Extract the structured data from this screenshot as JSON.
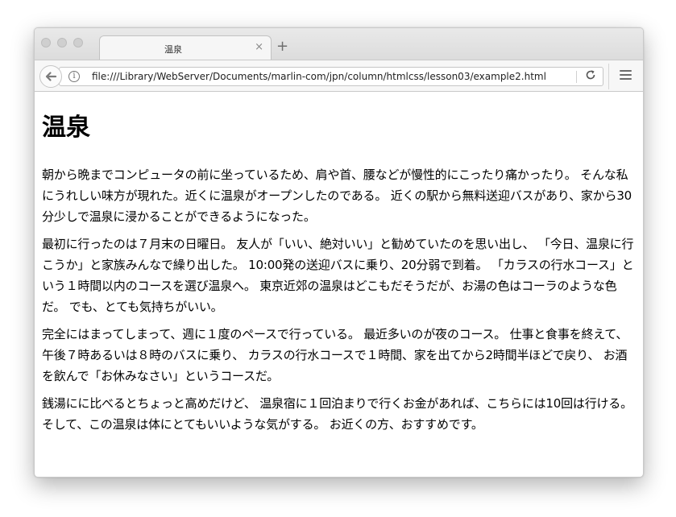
{
  "browser": {
    "tab": {
      "title": "温泉",
      "close_glyph": "×"
    },
    "new_tab_glyph": "+",
    "url": "file:///Library/WebServer/Documents/marlin-com/jpn/column/htmlcss/lesson03/example2.html",
    "icons": {
      "back": "back-arrow-icon",
      "info": "info-icon",
      "reload": "reload-icon",
      "menu": "hamburger-menu-icon"
    }
  },
  "page": {
    "heading": "温泉",
    "paragraphs": [
      "朝から晩までコンピュータの前に坐っているため、肩や首、腰などが慢性的にこったり痛かったり。 そんな私にうれしい味方が現れた。近くに温泉がオープンしたのである。 近くの駅から無料送迎バスがあり、家から30分少しで温泉に浸かることができるようになった。",
      "最初に行ったのは７月末の日曜日。 友人が「いい、絶対いい」と勧めていたのを思い出し、 「今日、温泉に行こうか」と家族みんなで繰り出した。 10:00発の送迎バスに乗り、20分弱で到着。 「カラスの行水コース」という１時間以内のコースを選び温泉へ。 東京近郊の温泉はどこもだそうだが、お湯の色はコーラのような色だ。 でも、とても気持ちがいい。",
      "完全にはまってしまって、週に１度のペースで行っている。 最近多いのが夜のコース。 仕事と食事を終えて、午後７時あるいは８時のバスに乗り、 カラスの行水コースで１時間、家を出てから2時間半ほどで戻り、 お酒を飲んで「お休みなさい」というコースだ。",
      "銭湯にに比べるとちょっと高めだけど、 温泉宿に１回泊まりで行くお金があれば、こちらには10回は行ける。 そして、この温泉は体にとてもいいような気がする。 お近くの方、おすすめです。"
    ]
  }
}
